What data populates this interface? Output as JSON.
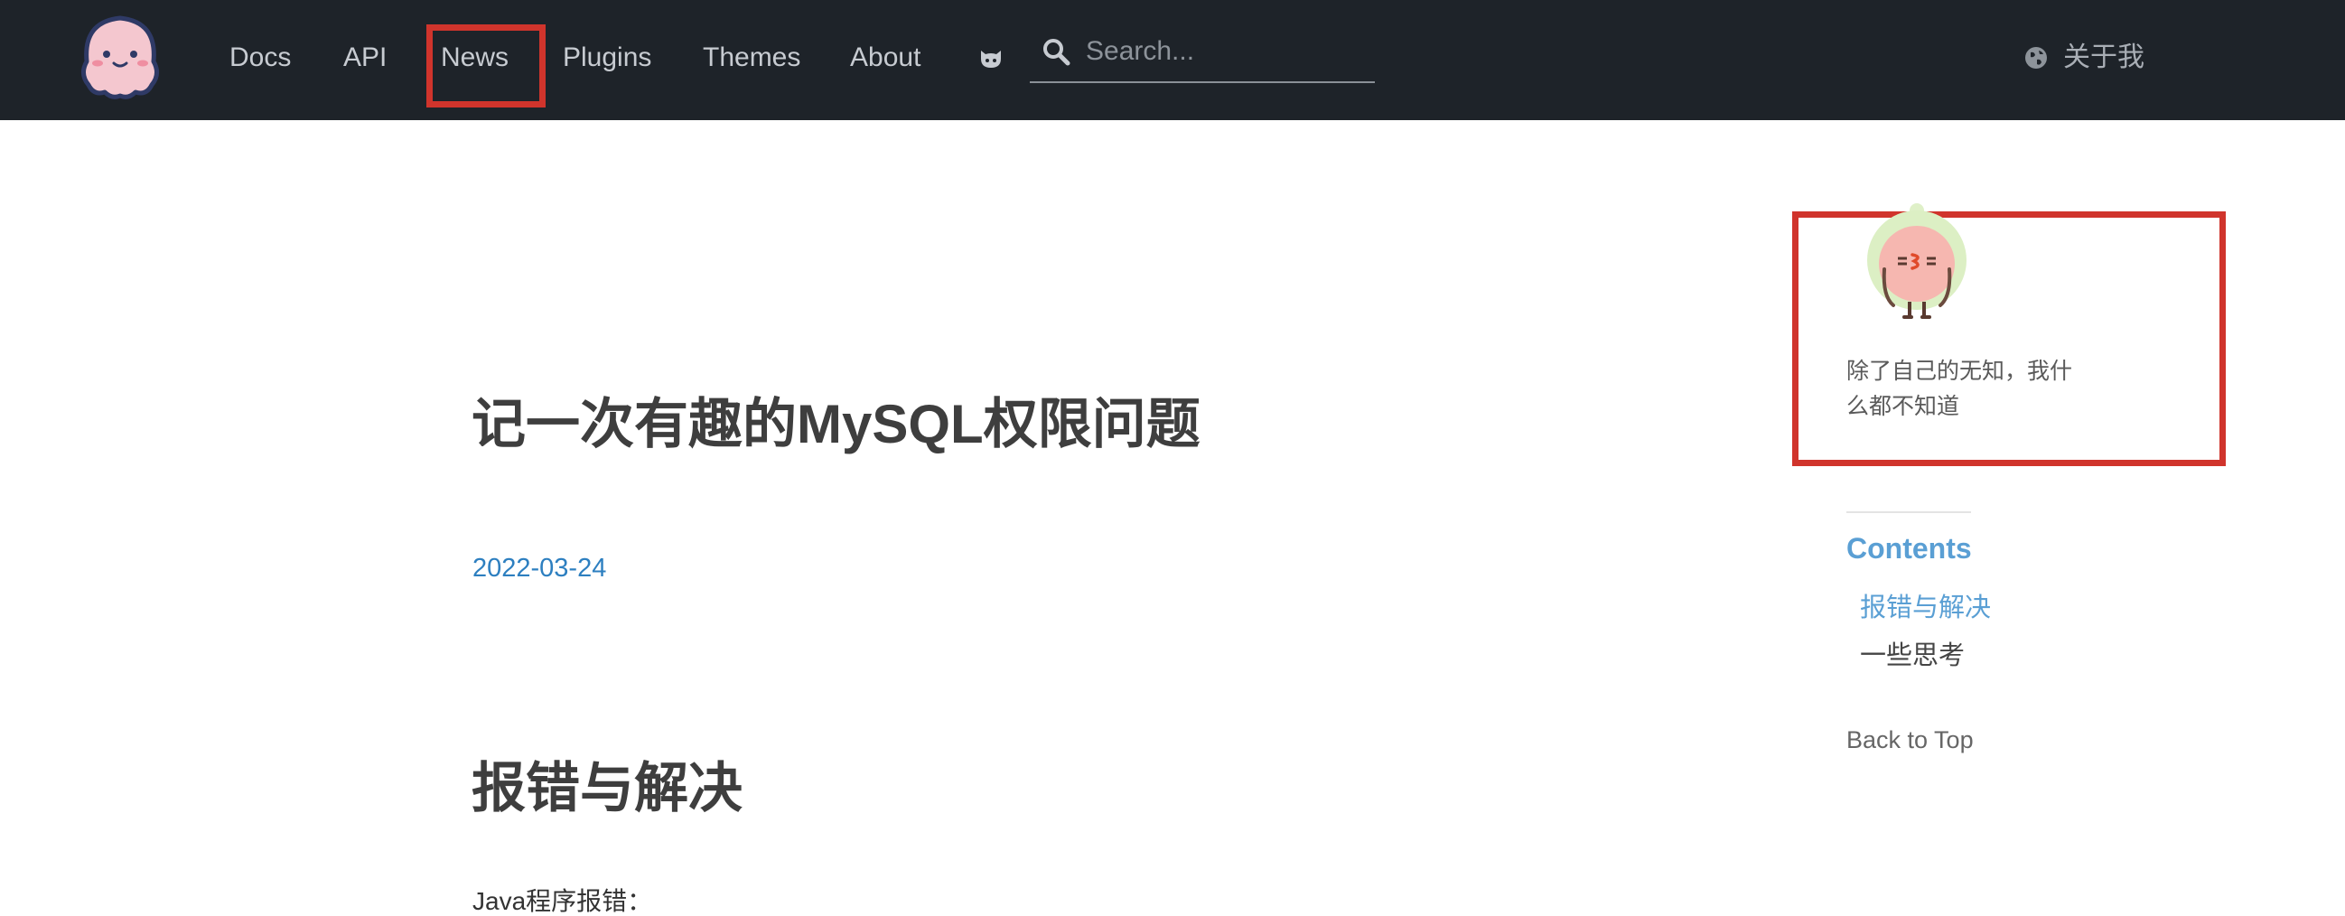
{
  "nav": {
    "links": [
      "Docs",
      "API",
      "News",
      "Plugins",
      "Themes",
      "About"
    ],
    "search": {
      "placeholder": "Search..."
    },
    "language_label": "关于我",
    "icons": [
      "octopus-logo",
      "github-icon",
      "search-icon",
      "globe-icon"
    ]
  },
  "article": {
    "title": "记一次有趣的MySQL权限问题",
    "date": "2022-03-24",
    "section_heading": "报错与解决",
    "body_start": "Java程序报错："
  },
  "sidebar": {
    "bio_line1": "除了自己的无知，我什",
    "bio_line2": "么都不知道",
    "toc_title": "Contents",
    "toc_items": [
      "报错与解决",
      "一些思考"
    ],
    "back_to_top": "Back to Top"
  },
  "colors": {
    "nav_background": "#1e2329",
    "nav_text": "#c7cbd1",
    "link_blue": "#2d7fc0",
    "toc_blue": "#5a9fd4",
    "annotation_red": "#d0342c",
    "heading_text": "#3e3e3e"
  }
}
